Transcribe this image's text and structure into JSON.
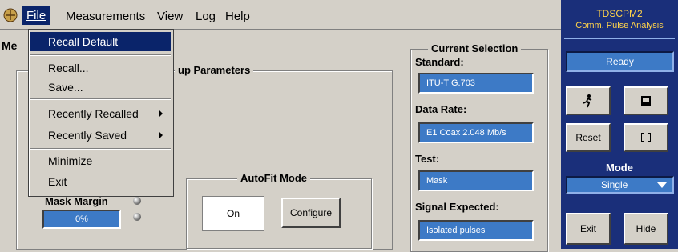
{
  "menubar": {
    "items": [
      {
        "label": "File"
      },
      {
        "label": "Measurements"
      },
      {
        "label": "View"
      },
      {
        "label": "Log"
      },
      {
        "label": "Help"
      }
    ]
  },
  "file_menu": {
    "items": [
      {
        "label": "Recall Default"
      },
      {
        "label": "Recall..."
      },
      {
        "label": "Save..."
      },
      {
        "label": "Recently Recalled"
      },
      {
        "label": "Recently Saved"
      },
      {
        "label": "Minimize"
      },
      {
        "label": "Exit"
      }
    ]
  },
  "main": {
    "tab_fragment": "Me",
    "setup_group_title": "up Parameters",
    "mask_margin_label": "Mask Margin",
    "mask_margin_value": "0%",
    "autofit": {
      "title": "AutoFit Mode",
      "value": "On",
      "configure_label": "Configure"
    },
    "current_selection": {
      "title": "Current Selection",
      "standard_label": "Standard:",
      "standard_value": "ITU-T G.703",
      "data_rate_label": "Data Rate:",
      "data_rate_value": "E1 Coax 2.048 Mb/s",
      "test_label": "Test:",
      "test_value": "Mask",
      "signal_label": "Signal Expected:",
      "signal_value": "Isolated pulses"
    }
  },
  "right_panel": {
    "title": "TDSCPM2",
    "subtitle": "Comm. Pulse Analysis",
    "status": "Ready",
    "reset_label": "Reset",
    "mode_label": "Mode",
    "mode_value": "Single",
    "exit_label": "Exit",
    "hide_label": "Hide",
    "colors": {
      "panel": "#1a2f7a",
      "accent_text": "#ffd34a",
      "field": "#3d7ac6"
    }
  }
}
